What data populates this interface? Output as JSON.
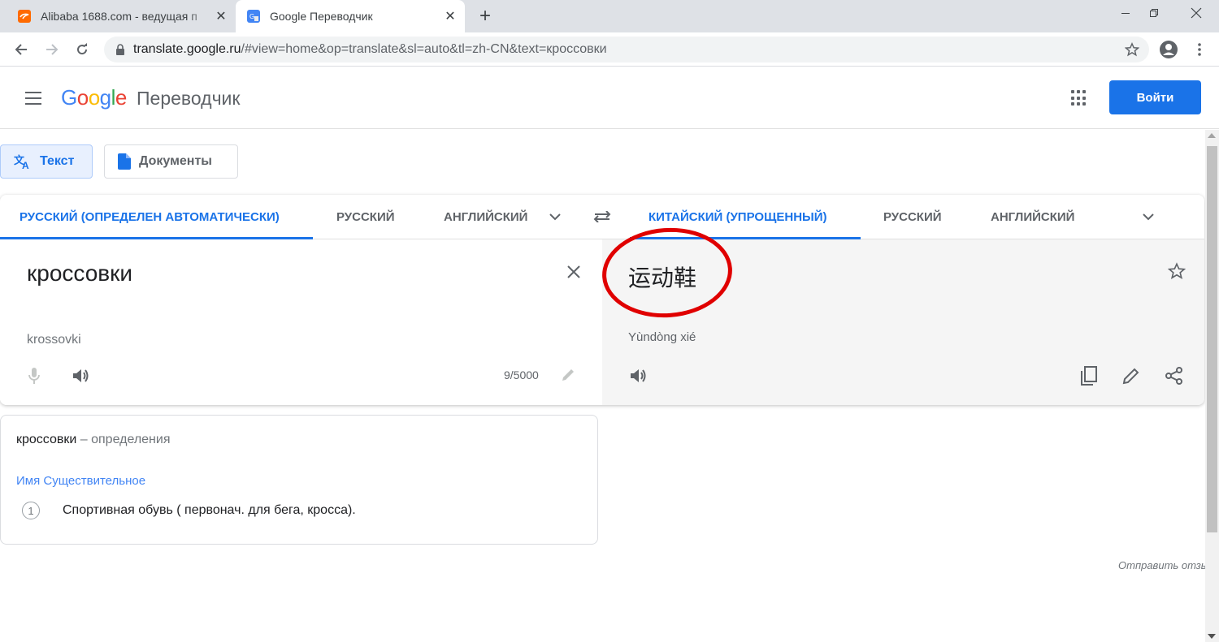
{
  "browser": {
    "tabs": [
      {
        "title": "Alibaba 1688.com - ведущая п",
        "favicon": "alibaba-icon",
        "active": false
      },
      {
        "title": "Google Переводчик",
        "favicon": "google-translate-icon",
        "active": true
      }
    ],
    "new_tab": "+",
    "url_host": "translate.google.ru",
    "url_rest": "/#view=home&op=translate&sl=auto&tl=zh-CN&text=кроссовки"
  },
  "header": {
    "logo_letters": [
      "G",
      "o",
      "o",
      "g",
      "l",
      "e"
    ],
    "product_name": "Переводчик",
    "signin_label": "Войти"
  },
  "modes": {
    "text_label": "Текст",
    "docs_label": "Документы"
  },
  "source_langs": [
    "РУССКИЙ (ОПРЕДЕЛЕН АВТОМАТИЧЕСКИ)",
    "РУССКИЙ",
    "АНГЛИЙСКИЙ"
  ],
  "target_langs": [
    "КИТАЙСКИЙ (УПРОЩЕННЫЙ)",
    "РУССКИЙ",
    "АНГЛИЙСКИЙ"
  ],
  "source": {
    "text": "кроссовки",
    "transliteration": "krossovki",
    "char_count": "9/5000"
  },
  "target": {
    "text": "运动鞋",
    "transliteration": "Yùndòng xié"
  },
  "definitions": {
    "word": "кроссовки",
    "suffix": " – определения",
    "part_of_speech": "Имя Существительное",
    "items": [
      {
        "number": "1",
        "text": "Спортивная обувь ( первонач. для бега, кросса)."
      }
    ]
  },
  "feedback_label": "Отправить отзыв",
  "colors": {
    "accent": "#1a73e8",
    "annotation": "#e00000"
  }
}
